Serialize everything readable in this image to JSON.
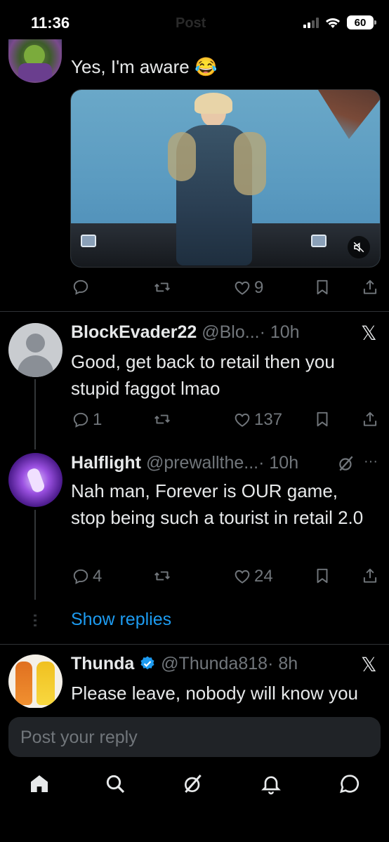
{
  "status_bar": {
    "time": "11:36",
    "battery": "60",
    "faded_title": "Post"
  },
  "tweet0": {
    "text": "Yes, I'm aware 😂",
    "likes": "9"
  },
  "reply1": {
    "name": "BlockEvader22",
    "handle": "@Blo...",
    "time": "· 10h",
    "text": "Good, get back to retail then you stupid faggot lmao",
    "replies": "1",
    "likes": "137"
  },
  "reply2": {
    "name": "Halflight",
    "handle": "@prewallthe...",
    "time": "· 10h",
    "text": "Nah man, Forever is OUR game, stop being such a tourist in retail 2.0",
    "replies": "4",
    "likes": "24",
    "more": "···"
  },
  "show_replies": "Show replies",
  "reply3": {
    "name": "Thunda",
    "handle": "@Thunda818",
    "time": "· 8h",
    "text": "Please leave, nobody will know you"
  },
  "composer": {
    "placeholder": "Post your reply"
  },
  "colors": {
    "accent": "#1d9bf0",
    "verified": "#1d9bf0",
    "muted": "#71767b",
    "background": "#000000"
  },
  "icons": [
    "reply-icon",
    "retweet-icon",
    "like-icon",
    "bookmark-icon",
    "share-icon",
    "x-logo-icon",
    "grok-icon",
    "home-icon",
    "search-icon",
    "notifications-icon",
    "messages-icon",
    "mute-icon"
  ]
}
